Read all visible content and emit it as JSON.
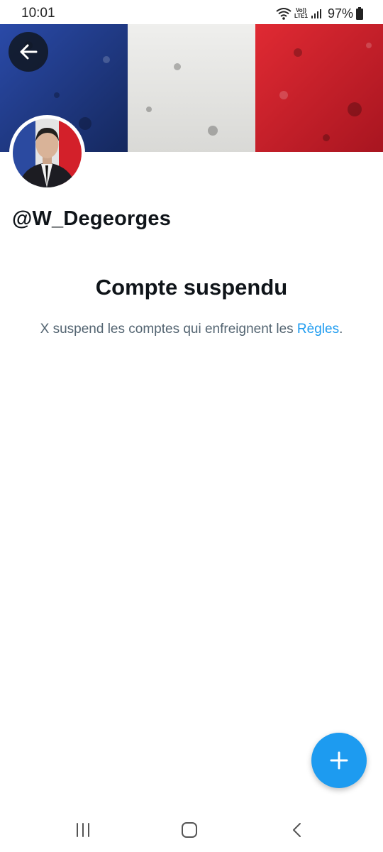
{
  "status_bar": {
    "time": "10:01",
    "network_label_top": "Vo))",
    "network_label_bottom": "LTE1",
    "battery": "97%"
  },
  "banner": {
    "theme": "french-flag",
    "colors": [
      "#1f3a8c",
      "#e8e8e6",
      "#d8202b"
    ]
  },
  "header": {
    "back_icon": "arrow-left-icon"
  },
  "profile": {
    "handle": "@W_Degeorges"
  },
  "suspension": {
    "title": "Compte suspendu",
    "text_before_link": "X suspend les comptes qui enfreignent les ",
    "link_text": "Règles",
    "text_after_link": "."
  },
  "fab": {
    "icon": "plus-icon",
    "color": "#1d9bf0"
  },
  "nav_bar": {
    "recents_icon": "recents-icon",
    "home_icon": "home-icon",
    "back_icon": "back-chevron-icon"
  }
}
